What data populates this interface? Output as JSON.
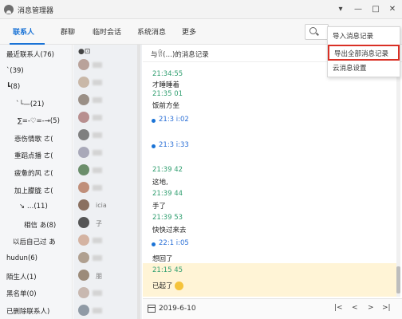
{
  "window": {
    "title": "消息管理器",
    "controls": [
      "▾",
      "—",
      "□",
      "✕"
    ]
  },
  "tabs": [
    {
      "label": "联系人",
      "active": true
    },
    {
      "label": "群聊",
      "active": false
    },
    {
      "label": "临时会话",
      "active": false
    },
    {
      "label": "系统消息",
      "active": false
    },
    {
      "label": "更多",
      "active": false
    }
  ],
  "menu": {
    "items": [
      {
        "label": "导入消息记录",
        "highlighted": false
      },
      {
        "label": "导出全部消息记录",
        "highlighted": true
      },
      {
        "label": "云消息设置",
        "highlighted": false
      }
    ]
  },
  "groups": [
    {
      "label": "最近联系人(76)"
    },
    {
      "label": "`(39)"
    },
    {
      "label": "┗(8)"
    },
    {
      "label": "`└—(21)"
    },
    {
      "label": "∑=-♡=-→(5)"
    },
    {
      "label": "悲伤情歌  ㄜ("
    },
    {
      "label": "重蹈点播  ㄜ("
    },
    {
      "label": "疲惫的风  ㄜ("
    },
    {
      "label": "加上朦胧  ㄜ("
    },
    {
      "label": "↘ …(11)"
    },
    {
      "label": "相信  あ(8)"
    },
    {
      "label": "以后自己过  あ"
    },
    {
      "label": "hudun(6)"
    },
    {
      "label": "陌生人(1)"
    },
    {
      "label": "黑名单(0)"
    },
    {
      "label": "已删除联系人)"
    }
  ],
  "contacts": [
    "",
    "",
    "",
    "",
    "",
    "",
    "",
    "",
    "icia",
    "子",
    "",
    "",
    "",
    "",
    "",
    "朋",
    "",
    "",
    ""
  ],
  "conversation": {
    "header": "与ꐠ(…)的消息记录",
    "messages": [
      {
        "time": "21:34:55",
        "text": "才睡睡着",
        "me": false
      },
      {
        "time": "21:35 01",
        "text": "饭前方坐",
        "me": false
      },
      {
        "time": "21:3 i:02",
        "text": "",
        "me": true
      },
      {
        "time": "21:3 i:33",
        "text": "",
        "me": true
      },
      {
        "time": "21:39 42",
        "text": "这地,",
        "me": false
      },
      {
        "time": "21:39 44",
        "text": "手了",
        "me": false
      },
      {
        "time": "21:39 53",
        "text": "快快过来去",
        "me": false
      },
      {
        "time": "22:1 i:05",
        "text": "",
        "me": true
      },
      {
        "time": "",
        "text": "想回了",
        "me": false
      },
      {
        "time": "21:15 45",
        "text": "已起了",
        "me": false
      }
    ]
  },
  "footer": {
    "date": "2019-6-10",
    "nav": [
      "|<",
      "<",
      ">",
      ">|"
    ]
  },
  "colors": {
    "accent": "#1a73d6",
    "highlight_border": "#d93025",
    "highlight_band": "#fff4d6"
  }
}
